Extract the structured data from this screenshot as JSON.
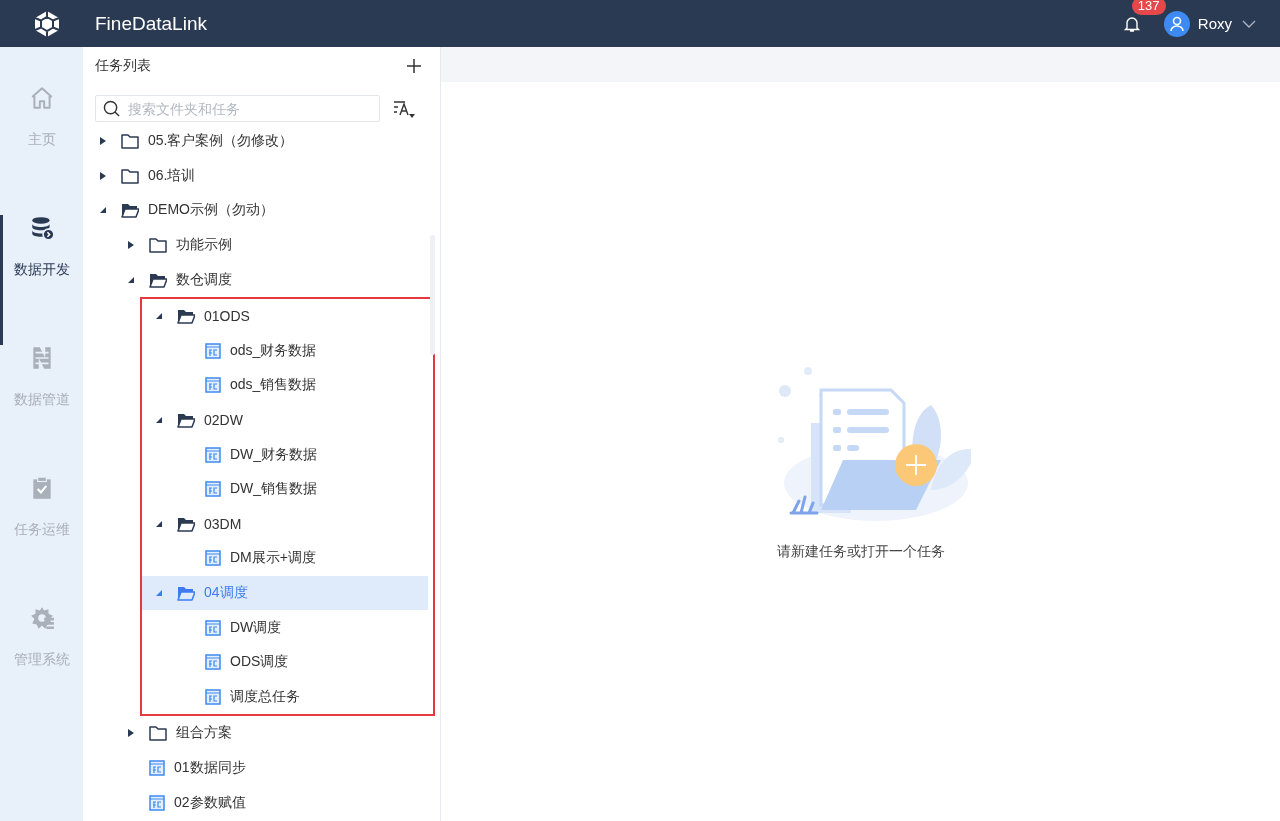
{
  "header": {
    "title": "FineDataLink",
    "notifications": "137",
    "user": "Roxy"
  },
  "nav": [
    {
      "label": "主页",
      "kind": "home",
      "selected": false
    },
    {
      "label": "数据开发",
      "kind": "database",
      "selected": true
    },
    {
      "label": "数据管道",
      "kind": "pipeline",
      "selected": false
    },
    {
      "label": "任务运维",
      "kind": "clipboard",
      "selected": false
    },
    {
      "label": "管理系统",
      "kind": "gear",
      "selected": false
    }
  ],
  "panel": {
    "title": "任务列表",
    "search": {
      "placeholder": "搜索文件夹和任务"
    }
  },
  "tree": [
    {
      "label": "05.客户案例（勿修改）",
      "kind": "folder",
      "expanded": false,
      "selected": false
    },
    {
      "label": "06.培训",
      "kind": "folder",
      "expanded": false,
      "selected": false
    },
    {
      "label": "DEMO示例（勿动）",
      "kind": "folder",
      "expanded": true,
      "selected": false,
      "children": [
        {
          "label": "功能示例",
          "kind": "folder",
          "expanded": false,
          "selected": false
        },
        {
          "label": "数仓调度",
          "kind": "folder",
          "expanded": true,
          "selected": false,
          "outlined": true,
          "children": [
            {
              "label": "01ODS",
              "kind": "folder",
              "expanded": true,
              "selected": false,
              "children": [
                {
                  "label": "ods_财务数据",
                  "kind": "task",
                  "selected": false
                },
                {
                  "label": "ods_销售数据",
                  "kind": "task",
                  "selected": false
                }
              ]
            },
            {
              "label": "02DW",
              "kind": "folder",
              "expanded": true,
              "selected": false,
              "children": [
                {
                  "label": "DW_财务数据",
                  "kind": "task",
                  "selected": false
                },
                {
                  "label": "DW_销售数据",
                  "kind": "task",
                  "selected": false
                }
              ]
            },
            {
              "label": "03DM",
              "kind": "folder",
              "expanded": true,
              "selected": false,
              "children": [
                {
                  "label": "DM展示+调度",
                  "kind": "task",
                  "selected": false
                }
              ]
            },
            {
              "label": "04调度",
              "kind": "folder",
              "expanded": true,
              "selected": true,
              "children": [
                {
                  "label": "DW调度",
                  "kind": "task",
                  "selected": false
                },
                {
                  "label": "ODS调度",
                  "kind": "task",
                  "selected": false
                },
                {
                  "label": "调度总任务",
                  "kind": "task",
                  "selected": false
                }
              ]
            }
          ]
        },
        {
          "label": "组合方案",
          "kind": "folder",
          "expanded": false,
          "selected": false
        },
        {
          "label": "01数据同步",
          "kind": "task",
          "selected": false
        },
        {
          "label": "02参数赋值",
          "kind": "task",
          "selected": false
        }
      ]
    }
  ],
  "empty_state": {
    "message": "请新建任务或打开一个任务"
  }
}
